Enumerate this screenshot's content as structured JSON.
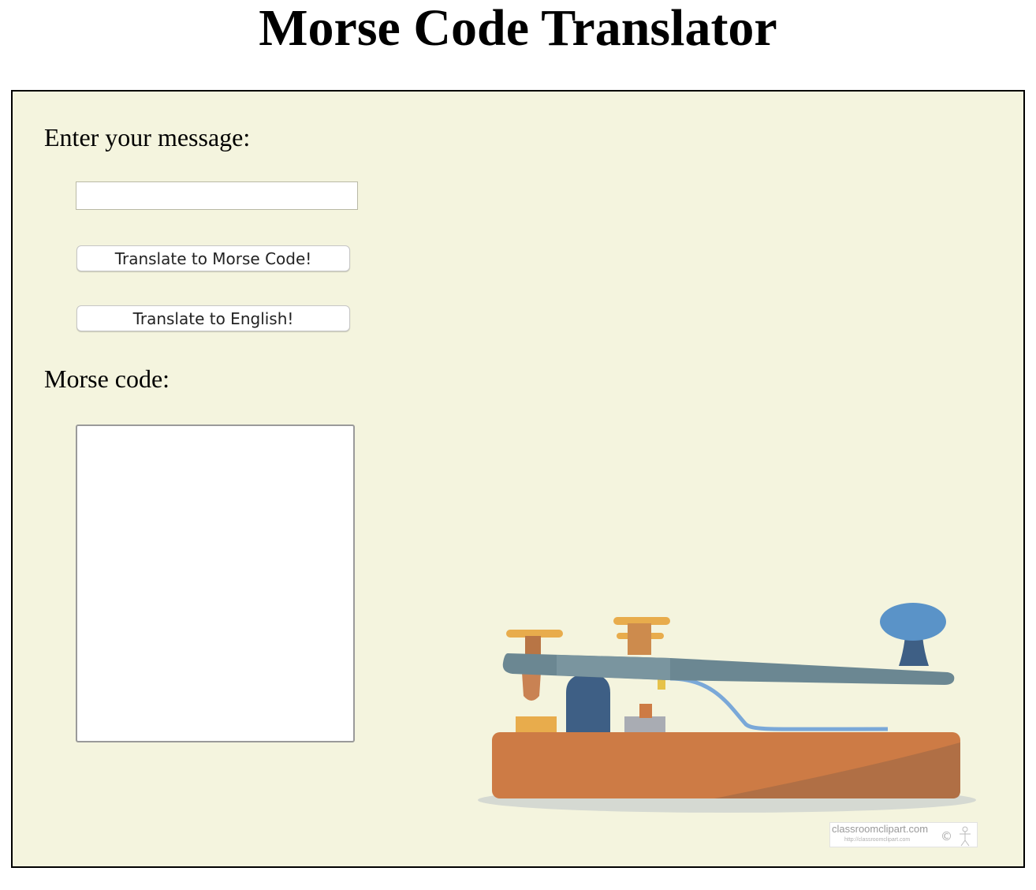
{
  "page": {
    "title": "Morse Code Translator"
  },
  "form": {
    "message_label": "Enter your message:",
    "message_value": "",
    "translate_to_morse_label": "Translate to Morse Code!",
    "translate_to_english_label": "Translate to English!",
    "morse_label": "Morse code:",
    "morse_output_value": ""
  },
  "illustration": {
    "subject": "telegraph-key",
    "watermark_text": "classroomclipart.com",
    "watermark_subtext": "http://classroomclipart.com"
  },
  "colors": {
    "panel_background": "#f4f4de",
    "panel_border": "#000000",
    "key_base": "#cd7b45",
    "key_lever": "#6b8792",
    "key_knob": "#5a93c8"
  }
}
